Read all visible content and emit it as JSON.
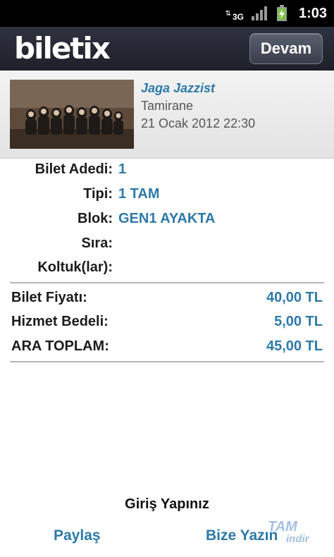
{
  "status_bar": {
    "time": "1:03",
    "network": "3G"
  },
  "header": {
    "logo": "biletix",
    "continue_button": "Devam"
  },
  "event": {
    "title": "Jaga Jazzist",
    "venue": "Tamirane",
    "date": "21 Ocak 2012 22:30"
  },
  "ticket": {
    "count_label": "Bilet Adedi:",
    "count_value": "1",
    "type_label": "Tipi:",
    "type_value": "1 TAM",
    "block_label": "Blok:",
    "block_value": "GEN1 AYAKTA",
    "row_label": "Sıra:",
    "row_value": "",
    "seat_label": "Koltuk(lar):",
    "seat_value": ""
  },
  "prices": {
    "ticket_price_label": "Bilet Fiyatı:",
    "ticket_price_value": "40,00 TL",
    "service_fee_label": "Hizmet Bedeli:",
    "service_fee_value": "5,00 TL",
    "subtotal_label": "ARA TOPLAM:",
    "subtotal_value": "45,00 TL"
  },
  "footer": {
    "login": "Giriş Yapınız",
    "share": "Paylaş",
    "contact": "Bize Yazın"
  },
  "watermark": {
    "line1": "TAM",
    "line2": "indir"
  },
  "colors": {
    "accent": "#2d7aa8",
    "header_bg": "#23252f",
    "text": "#1b1b1b"
  }
}
